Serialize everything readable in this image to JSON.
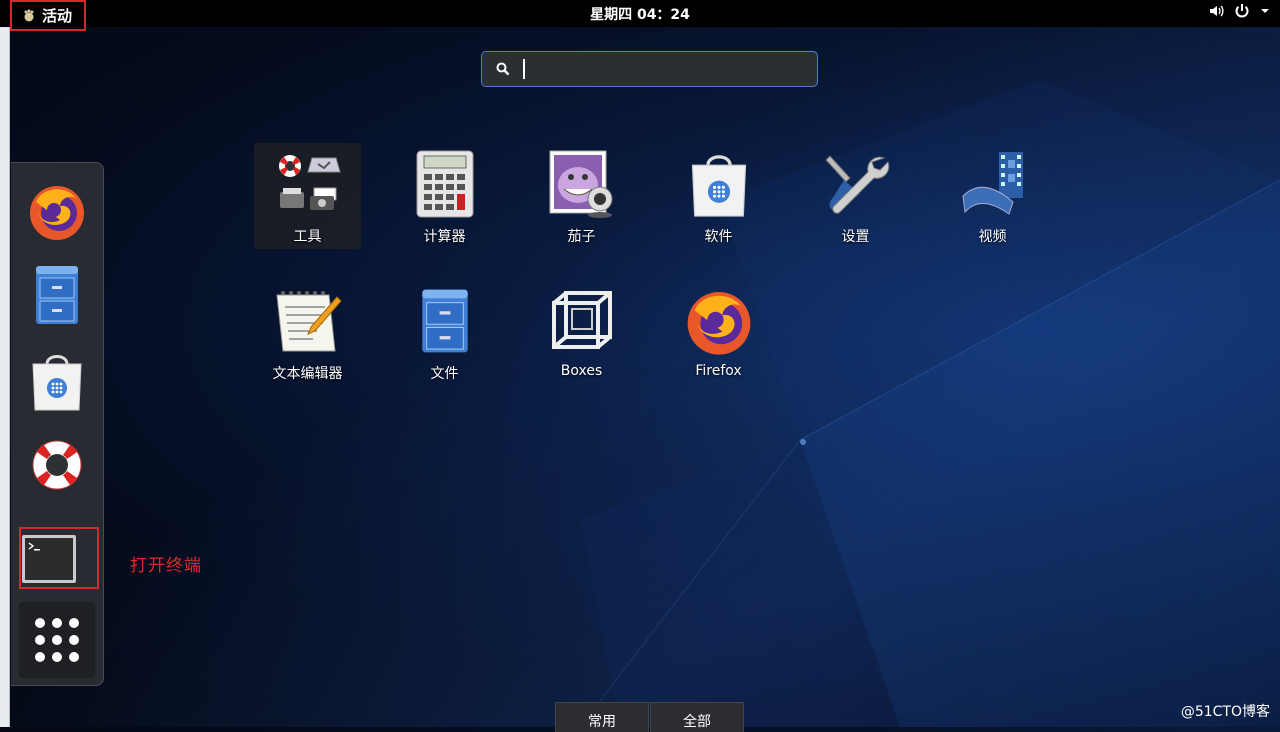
{
  "topbar": {
    "activities_label": "活动",
    "clock": "星期四 04：24"
  },
  "search": {
    "value": "",
    "placeholder": ""
  },
  "dash": {
    "items": [
      {
        "name": "firefox",
        "icon": "firefox-icon"
      },
      {
        "name": "files",
        "icon": "file-cabinet-icon"
      },
      {
        "name": "software",
        "icon": "software-bag-icon"
      },
      {
        "name": "help",
        "icon": "lifebuoy-icon"
      },
      {
        "name": "terminal",
        "icon": "terminal-icon"
      }
    ],
    "show_apps_icon": "grid-dots-icon"
  },
  "annotation": "打开终端",
  "apps": [
    {
      "label": "工具",
      "icon": "utilities-folder-icon"
    },
    {
      "label": "计算器",
      "icon": "calculator-icon"
    },
    {
      "label": "茄子",
      "icon": "cheese-webcam-icon"
    },
    {
      "label": "软件",
      "icon": "software-bag-icon"
    },
    {
      "label": "设置",
      "icon": "settings-wrench-icon"
    },
    {
      "label": "视频",
      "icon": "video-film-icon"
    },
    {
      "label": "文本编辑器",
      "icon": "text-editor-icon"
    },
    {
      "label": "文件",
      "icon": "file-cabinet-icon"
    },
    {
      "label": "Boxes",
      "icon": "boxes-cube-icon"
    },
    {
      "label": "Firefox",
      "icon": "firefox-icon"
    }
  ],
  "tabs": {
    "frequent": "常用",
    "all": "全部"
  },
  "watermark": "@51CTO博客",
  "colors": {
    "highlight": "#d32a2a",
    "search_border": "#4a7fd0",
    "panel": "#2d3034"
  }
}
